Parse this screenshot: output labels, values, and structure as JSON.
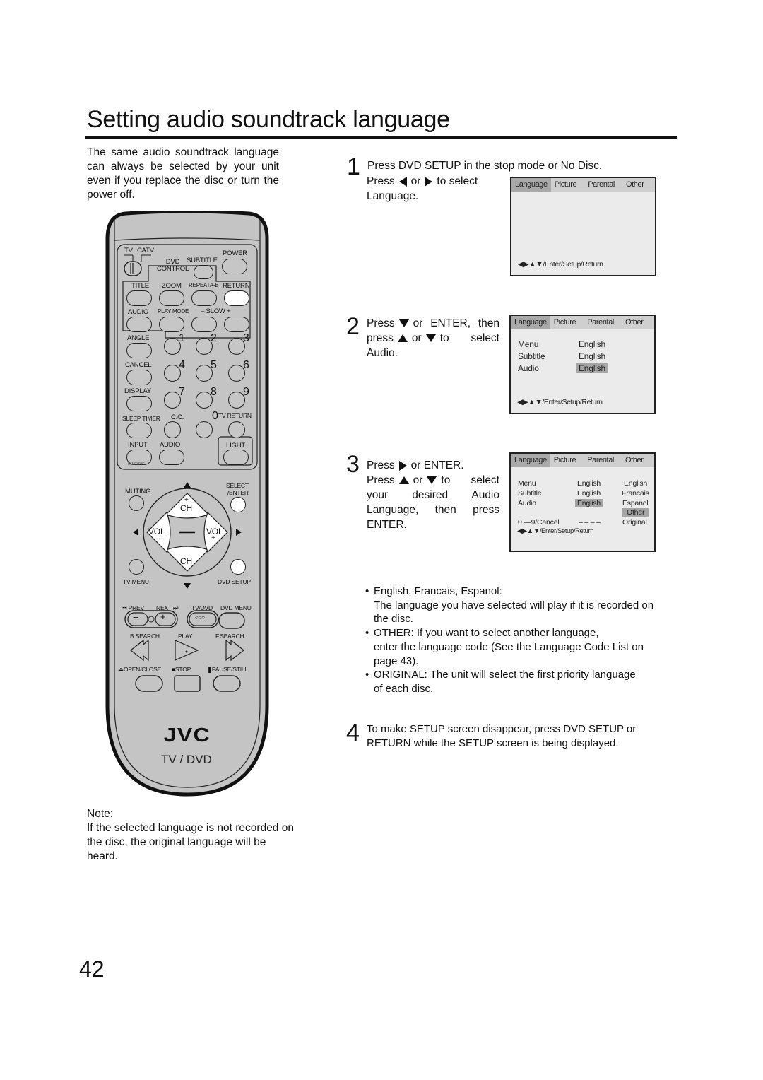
{
  "page": {
    "title": "Setting audio soundtrack language",
    "intro": "The same audio soundtrack language can always be selected by your unit even if you replace the disc or turn the power off.",
    "page_number": "42"
  },
  "steps": [
    {
      "number": "1",
      "line1": "Press DVD SETUP in the stop mode or No Disc.",
      "parts": [
        "Press",
        "or",
        "to select Language."
      ]
    },
    {
      "number": "2",
      "parts": [
        "Press",
        "or ENTER, then press",
        "or",
        "to select Audio."
      ]
    },
    {
      "number": "3",
      "parts": [
        "Press",
        "or ENTER.",
        "Press",
        "or",
        "to select your desired Audio Language, then press ENTER."
      ]
    },
    {
      "number": "4",
      "text": "To make SETUP screen disappear, press DVD SETUP or RETURN while the SETUP screen is being displayed."
    }
  ],
  "osd": {
    "tabs": [
      "Language",
      "Picture",
      "Parental",
      "Other"
    ],
    "active_tab": "Language",
    "footer": "◀▶▲▼/Enter/Setup/Return",
    "items": [
      {
        "label": "Menu",
        "value": "English"
      },
      {
        "label": "Subtitle",
        "value": "English"
      },
      {
        "label": "Audio",
        "value": "English"
      }
    ],
    "options": [
      "English",
      "Francais",
      "Espanol",
      "Other",
      "Original"
    ],
    "highlighted_option": "Other",
    "code_entry_label": "0 —9/Cancel",
    "code_entry_value": "– – – –"
  },
  "bullets": [
    {
      "head": "English, Francais, Espanol:",
      "body": "The language you have selected will play if it is recorded on the disc."
    },
    {
      "head": "OTHER: If you want to select another language,",
      "body": "enter the language code (See the Language Code List on page 43)."
    },
    {
      "head": "ORIGINAL:  The unit will select the first priority language",
      "body": "of each disc."
    }
  ],
  "note": {
    "label": "Note:",
    "text": "If the selected language is not recorded on the disc, the original language will be heard."
  },
  "remote": {
    "brand": "JVC",
    "model_line": "TV / DVD",
    "model_code": "RM-C394G",
    "labels": {
      "tv": "TV",
      "catv": "CATV",
      "power": "POWER",
      "dvd_control": "DVD\nCONTROL",
      "subtitle": "SUBTITLE",
      "title": "TITLE",
      "zoom": "ZOOM",
      "repeat_ab": "REPEATA-B",
      "return": "RETURN",
      "audio": "AUDIO",
      "play_mode": "PLAY MODE",
      "slow": "–  SLOW  +",
      "angle": "ANGLE",
      "cancel": "CANCEL",
      "display": "DISPLAY",
      "sleep_timer": "SLEEP TIMER",
      "cc": "C.C.",
      "tv_return": "TV RETURN",
      "input": "INPUT",
      "audio2": "AUDIO",
      "light": "LIGHT",
      "muting": "MUTING",
      "select_enter": "SELECT\n/ENTER",
      "ch": "CH",
      "vol": "VOL",
      "tv_menu": "TV MENU",
      "dvd_setup": "DVD SETUP",
      "prev": "⏮ PREV",
      "next": "NEXT ⏭",
      "tv_dvd": "TV/DVD",
      "dvd_menu": "DVD MENU",
      "b_search": "B.SEARCH",
      "play": "PLAY",
      "f_search": "F.SEARCH",
      "open_close": "⏏OPEN/CLOSE",
      "stop": "■STOP",
      "pause_still": "❚PAUSE/STILL"
    },
    "digits": [
      "1",
      "2",
      "3",
      "4",
      "5",
      "6",
      "7",
      "8",
      "9",
      "0"
    ]
  }
}
